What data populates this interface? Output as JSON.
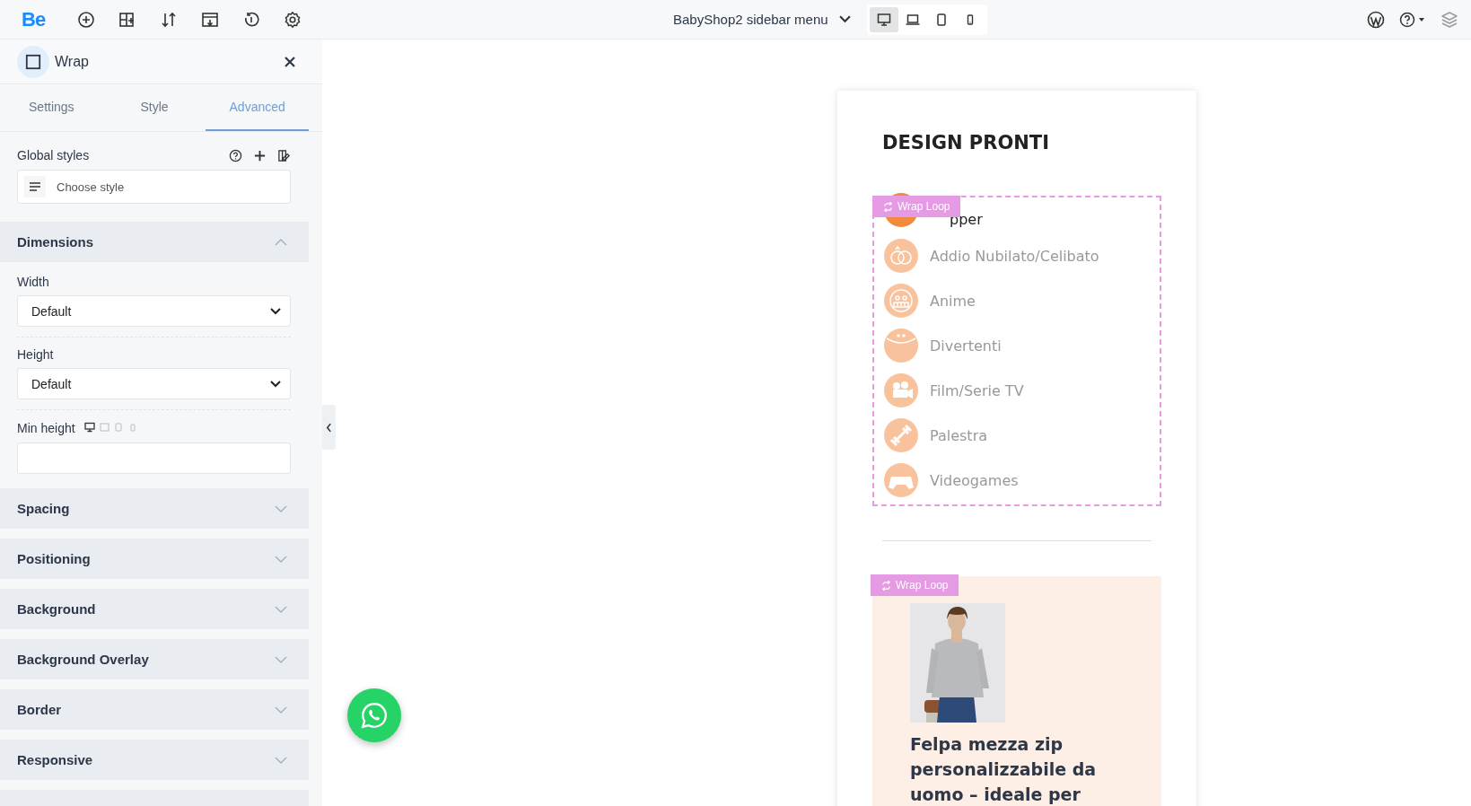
{
  "topbar": {
    "logo": "Be",
    "page_title": "BabyShop2 sidebar menu",
    "viewports": [
      {
        "selected": true
      },
      {
        "selected": false
      },
      {
        "selected": false
      },
      {
        "selected": false
      }
    ]
  },
  "panel": {
    "title": "Wrap",
    "tabs": [
      {
        "label": "Settings",
        "selected": false
      },
      {
        "label": "Style",
        "selected": false
      },
      {
        "label": "Advanced",
        "selected": true
      }
    ],
    "global_styles": {
      "label": "Global styles",
      "placeholder": "Choose style"
    },
    "sections": [
      {
        "title": "Dimensions",
        "expanded": true,
        "fields": [
          {
            "kind": "select",
            "label": "Width",
            "value": "Default"
          },
          {
            "kind": "select",
            "label": "Height",
            "value": "Default"
          },
          {
            "kind": "input",
            "label": "Min height"
          }
        ]
      },
      {
        "title": "Spacing",
        "expanded": false
      },
      {
        "title": "Positioning",
        "expanded": false
      },
      {
        "title": "Background",
        "expanded": false
      },
      {
        "title": "Background Overlay",
        "expanded": false
      },
      {
        "title": "Border",
        "expanded": false
      },
      {
        "title": "Responsive",
        "expanded": false
      }
    ]
  },
  "canvas": {
    "heading": "DESIGN PRONTI",
    "badge": "Wrap Loop",
    "categories": [
      {
        "label": "pper",
        "active": true
      },
      {
        "label": "Addio Nubilato/Celibato",
        "active": false
      },
      {
        "label": "Anime",
        "active": false
      },
      {
        "label": "Divertenti",
        "active": false
      },
      {
        "label": "Film/Serie TV",
        "active": false
      },
      {
        "label": "Palestra",
        "active": false
      },
      {
        "label": "Videogames",
        "active": false
      }
    ],
    "product": {
      "badge": "Wrap Loop",
      "title": "Felpa mezza zip personalizzabile da uomo – ideale per"
    }
  }
}
